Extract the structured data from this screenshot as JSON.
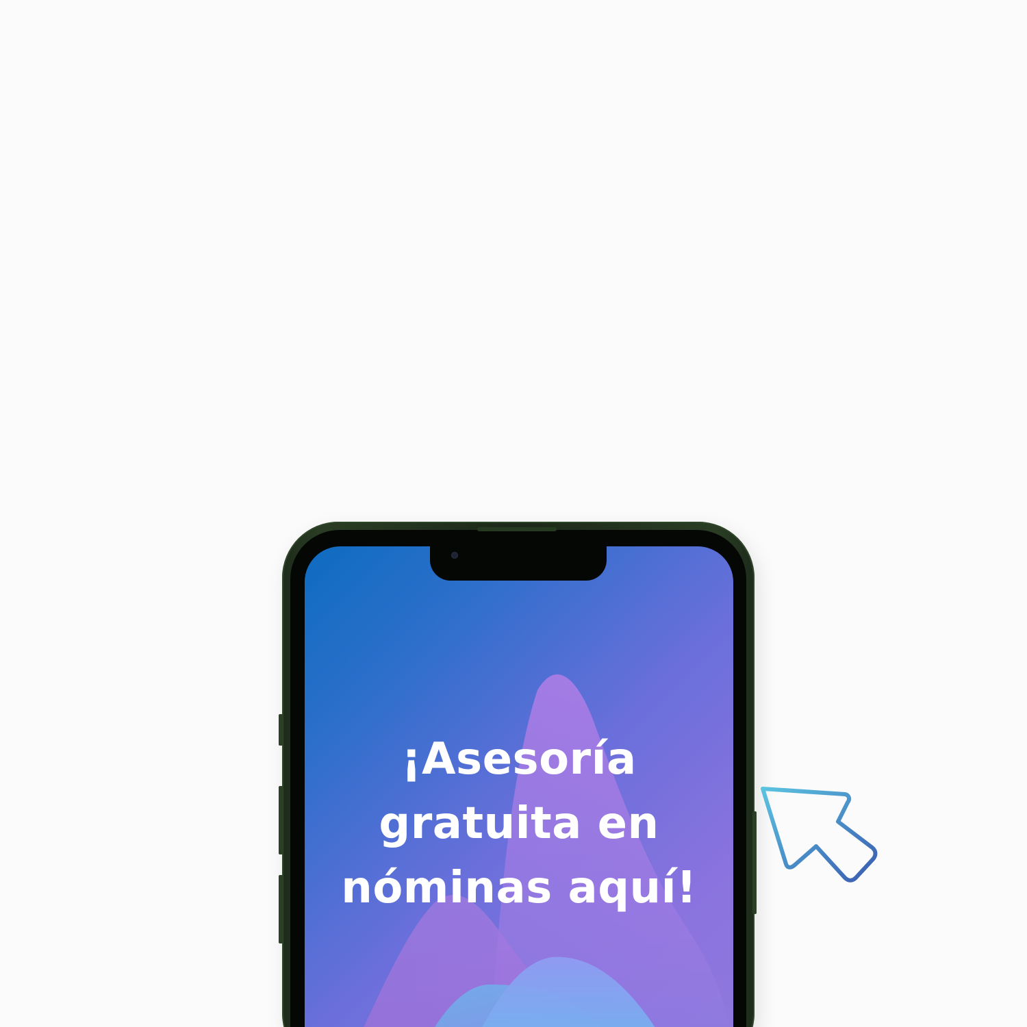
{
  "screen": {
    "headline_lines": [
      "¡Asesoría",
      "gratuita en",
      "nóminas aquí!"
    ]
  },
  "icons": {
    "cursor": "pointer-arrow-icon",
    "camera": "front-camera-icon"
  },
  "colors": {
    "background": "#fbfbfb",
    "phone_frame": "#1d2b1a",
    "screen_blue": "#0e6cc0",
    "screen_purple": "#8f79dd",
    "text": "#ffffff",
    "cursor_start": "#5bc3e0",
    "cursor_end": "#3a5cb0"
  }
}
